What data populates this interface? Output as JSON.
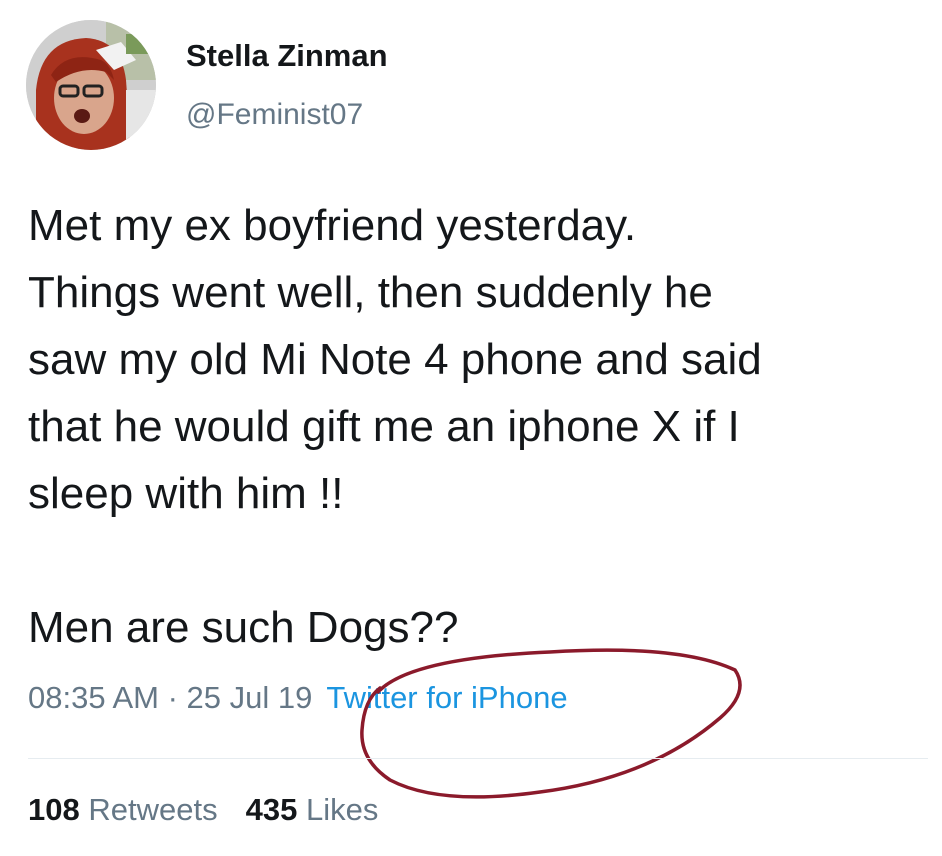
{
  "user": {
    "display_name": "Stella Zinman",
    "handle": "@Feminist07"
  },
  "tweet": {
    "lines": [
      "Met my ex boyfriend yesterday.",
      "Things went well, then suddenly he",
      "saw my old Mi Note 4 phone and said",
      "that he would gift me an iphone X if I",
      "sleep with him !!"
    ],
    "final_line": "Men are such Dogs??"
  },
  "meta": {
    "timestamp": "08:35 AM · 25 Jul 19",
    "source": "Twitter for iPhone"
  },
  "stats": {
    "retweets_count": "108",
    "retweets_label": "Retweets",
    "likes_count": "435",
    "likes_label": "Likes"
  },
  "colors": {
    "text": "#14171a",
    "muted": "#657786",
    "link": "#1b95e0",
    "annotation": "#8b1a2b"
  }
}
